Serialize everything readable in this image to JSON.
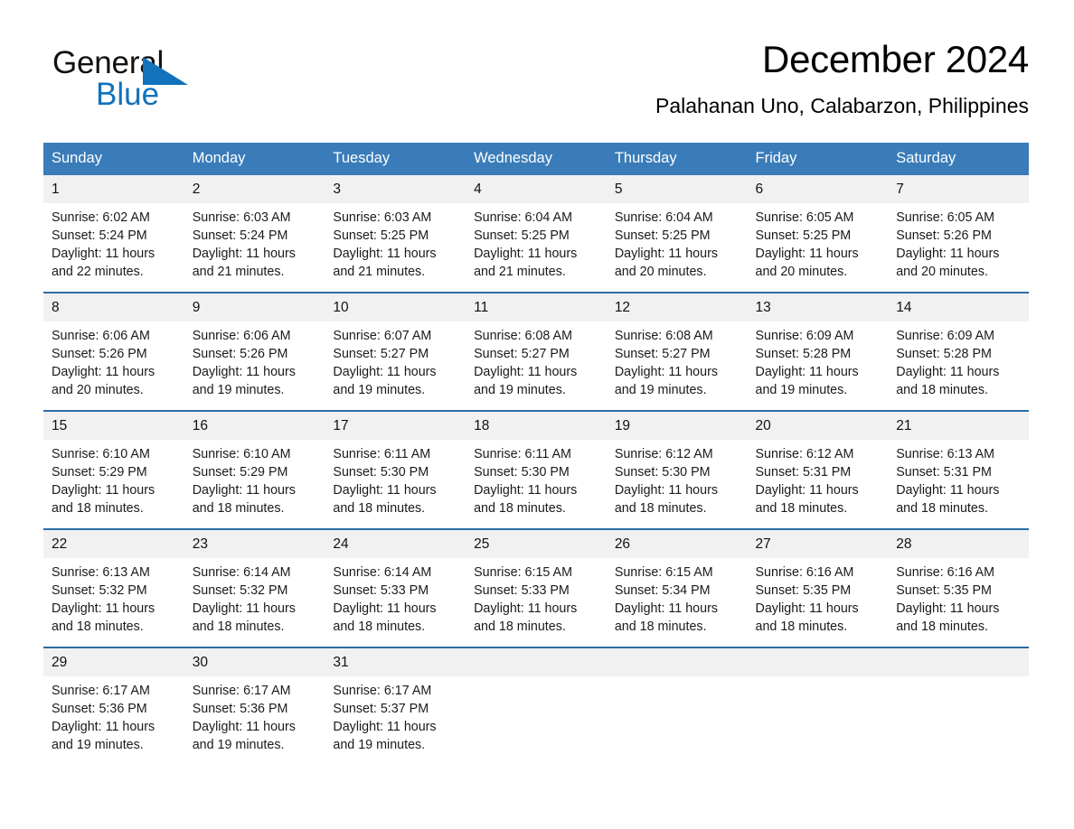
{
  "brand": {
    "name_part1": "General",
    "name_part2": "Blue",
    "triangle_color": "#1272bb",
    "text_color": "#111111"
  },
  "header": {
    "title": "December 2024",
    "subtitle": "Palahanan Uno, Calabarzon, Philippines"
  },
  "theme": {
    "header_blue": "#3a7cb9",
    "row_line_blue": "#2d6ca6",
    "daynum_band": "#f1f1f1",
    "logo_blue": "#1272bb"
  },
  "weekday_headers": [
    "Sunday",
    "Monday",
    "Tuesday",
    "Wednesday",
    "Thursday",
    "Friday",
    "Saturday"
  ],
  "weeks": [
    {
      "days": [
        {
          "num": "1",
          "sunrise": "Sunrise: 6:02 AM",
          "sunset": "Sunset: 5:24 PM",
          "daylight": "Daylight: 11 hours and 22 minutes."
        },
        {
          "num": "2",
          "sunrise": "Sunrise: 6:03 AM",
          "sunset": "Sunset: 5:24 PM",
          "daylight": "Daylight: 11 hours and 21 minutes."
        },
        {
          "num": "3",
          "sunrise": "Sunrise: 6:03 AM",
          "sunset": "Sunset: 5:25 PM",
          "daylight": "Daylight: 11 hours and 21 minutes."
        },
        {
          "num": "4",
          "sunrise": "Sunrise: 6:04 AM",
          "sunset": "Sunset: 5:25 PM",
          "daylight": "Daylight: 11 hours and 21 minutes."
        },
        {
          "num": "5",
          "sunrise": "Sunrise: 6:04 AM",
          "sunset": "Sunset: 5:25 PM",
          "daylight": "Daylight: 11 hours and 20 minutes."
        },
        {
          "num": "6",
          "sunrise": "Sunrise: 6:05 AM",
          "sunset": "Sunset: 5:25 PM",
          "daylight": "Daylight: 11 hours and 20 minutes."
        },
        {
          "num": "7",
          "sunrise": "Sunrise: 6:05 AM",
          "sunset": "Sunset: 5:26 PM",
          "daylight": "Daylight: 11 hours and 20 minutes."
        }
      ]
    },
    {
      "days": [
        {
          "num": "8",
          "sunrise": "Sunrise: 6:06 AM",
          "sunset": "Sunset: 5:26 PM",
          "daylight": "Daylight: 11 hours and 20 minutes."
        },
        {
          "num": "9",
          "sunrise": "Sunrise: 6:06 AM",
          "sunset": "Sunset: 5:26 PM",
          "daylight": "Daylight: 11 hours and 19 minutes."
        },
        {
          "num": "10",
          "sunrise": "Sunrise: 6:07 AM",
          "sunset": "Sunset: 5:27 PM",
          "daylight": "Daylight: 11 hours and 19 minutes."
        },
        {
          "num": "11",
          "sunrise": "Sunrise: 6:08 AM",
          "sunset": "Sunset: 5:27 PM",
          "daylight": "Daylight: 11 hours and 19 minutes."
        },
        {
          "num": "12",
          "sunrise": "Sunrise: 6:08 AM",
          "sunset": "Sunset: 5:27 PM",
          "daylight": "Daylight: 11 hours and 19 minutes."
        },
        {
          "num": "13",
          "sunrise": "Sunrise: 6:09 AM",
          "sunset": "Sunset: 5:28 PM",
          "daylight": "Daylight: 11 hours and 19 minutes."
        },
        {
          "num": "14",
          "sunrise": "Sunrise: 6:09 AM",
          "sunset": "Sunset: 5:28 PM",
          "daylight": "Daylight: 11 hours and 18 minutes."
        }
      ]
    },
    {
      "days": [
        {
          "num": "15",
          "sunrise": "Sunrise: 6:10 AM",
          "sunset": "Sunset: 5:29 PM",
          "daylight": "Daylight: 11 hours and 18 minutes."
        },
        {
          "num": "16",
          "sunrise": "Sunrise: 6:10 AM",
          "sunset": "Sunset: 5:29 PM",
          "daylight": "Daylight: 11 hours and 18 minutes."
        },
        {
          "num": "17",
          "sunrise": "Sunrise: 6:11 AM",
          "sunset": "Sunset: 5:30 PM",
          "daylight": "Daylight: 11 hours and 18 minutes."
        },
        {
          "num": "18",
          "sunrise": "Sunrise: 6:11 AM",
          "sunset": "Sunset: 5:30 PM",
          "daylight": "Daylight: 11 hours and 18 minutes."
        },
        {
          "num": "19",
          "sunrise": "Sunrise: 6:12 AM",
          "sunset": "Sunset: 5:30 PM",
          "daylight": "Daylight: 11 hours and 18 minutes."
        },
        {
          "num": "20",
          "sunrise": "Sunrise: 6:12 AM",
          "sunset": "Sunset: 5:31 PM",
          "daylight": "Daylight: 11 hours and 18 minutes."
        },
        {
          "num": "21",
          "sunrise": "Sunrise: 6:13 AM",
          "sunset": "Sunset: 5:31 PM",
          "daylight": "Daylight: 11 hours and 18 minutes."
        }
      ]
    },
    {
      "days": [
        {
          "num": "22",
          "sunrise": "Sunrise: 6:13 AM",
          "sunset": "Sunset: 5:32 PM",
          "daylight": "Daylight: 11 hours and 18 minutes."
        },
        {
          "num": "23",
          "sunrise": "Sunrise: 6:14 AM",
          "sunset": "Sunset: 5:32 PM",
          "daylight": "Daylight: 11 hours and 18 minutes."
        },
        {
          "num": "24",
          "sunrise": "Sunrise: 6:14 AM",
          "sunset": "Sunset: 5:33 PM",
          "daylight": "Daylight: 11 hours and 18 minutes."
        },
        {
          "num": "25",
          "sunrise": "Sunrise: 6:15 AM",
          "sunset": "Sunset: 5:33 PM",
          "daylight": "Daylight: 11 hours and 18 minutes."
        },
        {
          "num": "26",
          "sunrise": "Sunrise: 6:15 AM",
          "sunset": "Sunset: 5:34 PM",
          "daylight": "Daylight: 11 hours and 18 minutes."
        },
        {
          "num": "27",
          "sunrise": "Sunrise: 6:16 AM",
          "sunset": "Sunset: 5:35 PM",
          "daylight": "Daylight: 11 hours and 18 minutes."
        },
        {
          "num": "28",
          "sunrise": "Sunrise: 6:16 AM",
          "sunset": "Sunset: 5:35 PM",
          "daylight": "Daylight: 11 hours and 18 minutes."
        }
      ]
    },
    {
      "days": [
        {
          "num": "29",
          "sunrise": "Sunrise: 6:17 AM",
          "sunset": "Sunset: 5:36 PM",
          "daylight": "Daylight: 11 hours and 19 minutes."
        },
        {
          "num": "30",
          "sunrise": "Sunrise: 6:17 AM",
          "sunset": "Sunset: 5:36 PM",
          "daylight": "Daylight: 11 hours and 19 minutes."
        },
        {
          "num": "31",
          "sunrise": "Sunrise: 6:17 AM",
          "sunset": "Sunset: 5:37 PM",
          "daylight": "Daylight: 11 hours and 19 minutes."
        },
        {
          "num": "",
          "sunrise": "",
          "sunset": "",
          "daylight": ""
        },
        {
          "num": "",
          "sunrise": "",
          "sunset": "",
          "daylight": ""
        },
        {
          "num": "",
          "sunrise": "",
          "sunset": "",
          "daylight": ""
        },
        {
          "num": "",
          "sunrise": "",
          "sunset": "",
          "daylight": ""
        }
      ]
    }
  ]
}
